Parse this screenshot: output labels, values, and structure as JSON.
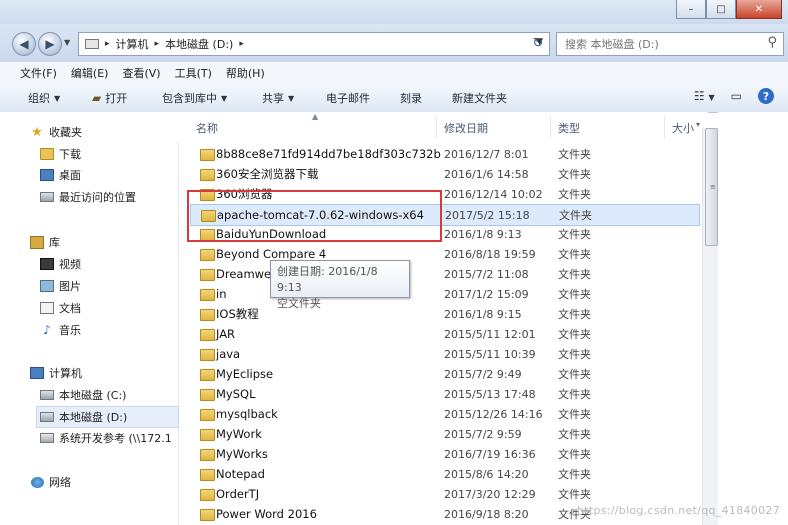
{
  "titlebar": {
    "min": "–",
    "max": "□",
    "close": "✕"
  },
  "nav": {
    "back": "◀",
    "forward": "▶",
    "dropdown": "▼",
    "breadcrumb": [
      "计算机",
      "本地磁盘 (D:)"
    ],
    "sep": "▸",
    "refresh": "↻",
    "search_placeholder": "搜索 本地磁盘 (D:)",
    "search_icon": "⚲"
  },
  "menu": [
    "文件(F)",
    "编辑(E)",
    "查看(V)",
    "工具(T)",
    "帮助(H)"
  ],
  "toolbar": {
    "organize": "组织",
    "open": "打开",
    "include": "包含到库中",
    "share": "共享",
    "email": "电子邮件",
    "burn": "刻录",
    "newfolder": "新建文件夹",
    "help": "?"
  },
  "sidebar": {
    "favorites": "收藏夹",
    "downloads": "下载",
    "desktop": "桌面",
    "recent": "最近访问的位置",
    "libraries": "库",
    "videos": "视频",
    "pictures": "图片",
    "documents": "文档",
    "music": "音乐",
    "computer": "计算机",
    "drive_c": "本地磁盘 (C:)",
    "drive_d": "本地磁盘 (D:)",
    "netdrive": "系统开发参考 (\\\\172.1",
    "network": "网络"
  },
  "columns": {
    "name": "名称",
    "date": "修改日期",
    "type": "类型",
    "size": "大小"
  },
  "files": [
    {
      "name": "8b88ce8e71fd914dd7be18df303c732b",
      "date": "2016/12/7 8:01",
      "type": "文件夹"
    },
    {
      "name": "360安全浏览器下载",
      "date": "2016/1/6 14:58",
      "type": "文件夹"
    },
    {
      "name": "360浏览器",
      "date": "2016/12/14 10:02",
      "type": "文件夹"
    },
    {
      "name": "apache-tomcat-7.0.62-windows-x64",
      "date": "2017/5/2 15:18",
      "type": "文件夹"
    },
    {
      "name": "BaiduYunDownload",
      "date": "2016/1/8 9:13",
      "type": "文件夹"
    },
    {
      "name": "Beyond Compare 4",
      "date": "2016/8/18 19:59",
      "type": "文件夹"
    },
    {
      "name": "Dreamweaver",
      "date": "2015/7/2 11:08",
      "type": "文件夹"
    },
    {
      "name": "in",
      "date": "2017/1/2 15:09",
      "type": "文件夹"
    },
    {
      "name": "IOS教程",
      "date": "2016/1/8 9:15",
      "type": "文件夹"
    },
    {
      "name": "JAR",
      "date": "2015/5/11 12:01",
      "type": "文件夹"
    },
    {
      "name": "java",
      "date": "2015/5/11 10:39",
      "type": "文件夹"
    },
    {
      "name": "MyEclipse",
      "date": "2015/7/2 9:49",
      "type": "文件夹"
    },
    {
      "name": "MySQL",
      "date": "2015/5/13 17:48",
      "type": "文件夹"
    },
    {
      "name": "mysqlback",
      "date": "2015/12/26 14:16",
      "type": "文件夹"
    },
    {
      "name": "MyWork",
      "date": "2015/7/2 9:59",
      "type": "文件夹"
    },
    {
      "name": "MyWorks",
      "date": "2016/7/19 16:36",
      "type": "文件夹"
    },
    {
      "name": "Notepad",
      "date": "2015/8/6 14:20",
      "type": "文件夹"
    },
    {
      "name": "OrderTJ",
      "date": "2017/3/20 12:29",
      "type": "文件夹"
    },
    {
      "name": "Power Word 2016",
      "date": "2016/9/18 8:20",
      "type": "文件夹"
    }
  ],
  "tooltip": {
    "line1": "创建日期: 2016/1/8 9:13",
    "line2": "空文件夹"
  },
  "watermark": "https://blog.csdn.net/qq_41840027"
}
